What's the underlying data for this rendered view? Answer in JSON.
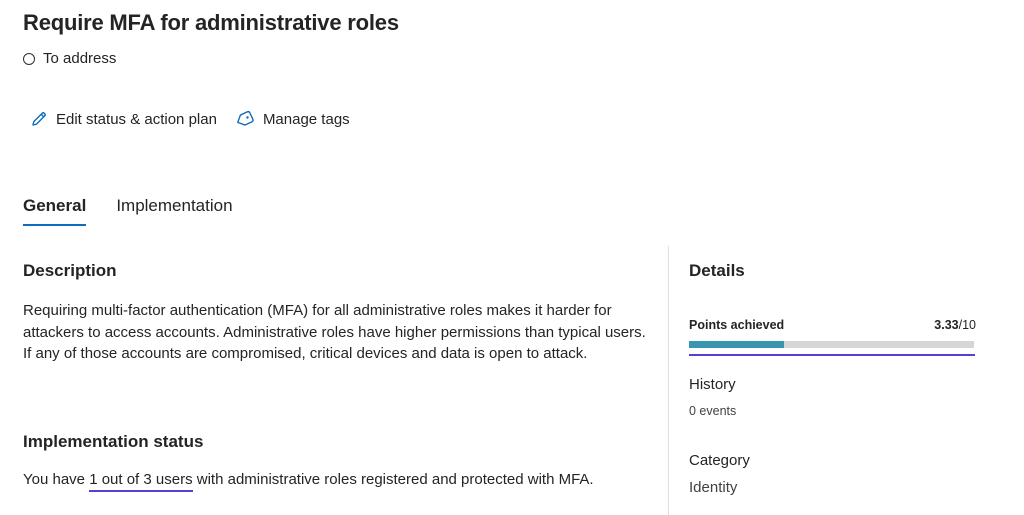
{
  "header": {
    "title": "Require MFA for administrative roles",
    "status": "To address"
  },
  "actions": {
    "edit_label": "Edit status & action plan",
    "tags_label": "Manage tags"
  },
  "tabs": [
    {
      "label": "General",
      "active": true
    },
    {
      "label": "Implementation",
      "active": false
    }
  ],
  "description": {
    "heading": "Description",
    "text": "Requiring multi-factor authentication (MFA) for all administrative roles makes it harder for attackers to access accounts. Administrative roles have higher permissions than typical users. If any of those accounts are compromised, critical devices and data is open to attack."
  },
  "implementation_status": {
    "heading": "Implementation status",
    "prefix": "You have ",
    "link_text": "1 out of 3 users",
    "suffix": " with administrative roles registered and protected with MFA."
  },
  "details": {
    "heading": "Details",
    "points_label": "Points achieved",
    "points_value": "3.33",
    "points_total": "/10",
    "points_fraction": 0.333,
    "history_label": "History",
    "history_value": "0 events",
    "category_label": "Category",
    "category_value": "Identity"
  },
  "colors": {
    "accent": "#0f6cbd",
    "progress": "#3a96b0",
    "underline": "#5b3fd1"
  }
}
